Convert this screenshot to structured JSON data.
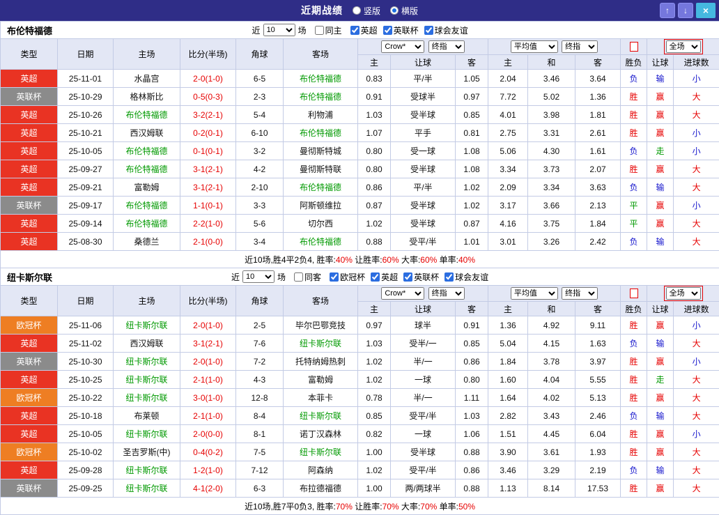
{
  "topbar": {
    "title": "近期战绩",
    "radios": [
      {
        "label": "竖版",
        "selected": false
      },
      {
        "label": "横版",
        "selected": true
      }
    ],
    "buttons": {
      "up": "↑",
      "down": "↓",
      "close": "×"
    }
  },
  "colors": {
    "topbar_bg": "#2f2d87",
    "header_bg": "#e3e7f5",
    "team_highlight": "#009900",
    "score": "#e60000",
    "badge": {
      "英超": "#e93323",
      "英联杯": "#8b8b8b",
      "欧冠杯": "#ee7e23"
    },
    "result": {
      "win": "#e60000",
      "loss": "#1414cc",
      "draw": "#009900"
    }
  },
  "table_header": {
    "left_cols": [
      "类型",
      "日期",
      "主场",
      "比分(半场)",
      "角球",
      "客场"
    ],
    "odds_selects_1": [
      "Crow*",
      "终指"
    ],
    "odds_selects_2": [
      "平均值",
      "终指"
    ],
    "scope_select": "全场",
    "sub_cols": [
      "主",
      "让球",
      "客",
      "主",
      "和",
      "客",
      "胜负",
      "让球",
      "进球数"
    ]
  },
  "sections": [
    {
      "team": "布伦特福德",
      "filter": {
        "near": "近",
        "count": "10",
        "games": "场",
        "same": {
          "label": "同主",
          "checked": false
        },
        "leagues": [
          {
            "label": "英超",
            "checked": true
          },
          {
            "label": "英联杯",
            "checked": true
          },
          {
            "label": "球会友谊",
            "checked": true
          }
        ]
      },
      "rows": [
        {
          "type": "英超",
          "date": "25-11-01",
          "home": "水晶宫",
          "home_team": false,
          "score": "2-0(1-0)",
          "corner": "6-5",
          "away": "布伦特福德",
          "away_team": true,
          "ah": [
            "0.83",
            "平/半",
            "1.05"
          ],
          "eu": [
            "2.04",
            "3.46",
            "3.64"
          ],
          "res": [
            [
              "负",
              "loss"
            ],
            [
              "输",
              "loss"
            ],
            [
              "小",
              "loss"
            ]
          ]
        },
        {
          "type": "英联杯",
          "date": "25-10-29",
          "home": "格林斯比",
          "home_team": false,
          "score": "0-5(0-3)",
          "corner": "2-3",
          "away": "布伦特福德",
          "away_team": true,
          "ah": [
            "0.91",
            "受球半",
            "0.97"
          ],
          "eu": [
            "7.72",
            "5.02",
            "1.36"
          ],
          "res": [
            [
              "胜",
              "win"
            ],
            [
              "赢",
              "win"
            ],
            [
              "大",
              "win"
            ]
          ]
        },
        {
          "type": "英超",
          "date": "25-10-26",
          "home": "布伦特福德",
          "home_team": true,
          "score": "3-2(2-1)",
          "corner": "5-4",
          "away": "利物浦",
          "away_team": false,
          "ah": [
            "1.03",
            "受半球",
            "0.85"
          ],
          "eu": [
            "4.01",
            "3.98",
            "1.81"
          ],
          "res": [
            [
              "胜",
              "win"
            ],
            [
              "赢",
              "win"
            ],
            [
              "大",
              "win"
            ]
          ]
        },
        {
          "type": "英超",
          "date": "25-10-21",
          "home": "西汉姆联",
          "home_team": false,
          "score": "0-2(0-1)",
          "corner": "6-10",
          "away": "布伦特福德",
          "away_team": true,
          "ah": [
            "1.07",
            "平手",
            "0.81"
          ],
          "eu": [
            "2.75",
            "3.31",
            "2.61"
          ],
          "res": [
            [
              "胜",
              "win"
            ],
            [
              "赢",
              "win"
            ],
            [
              "小",
              "loss"
            ]
          ]
        },
        {
          "type": "英超",
          "date": "25-10-05",
          "home": "布伦特福德",
          "home_team": true,
          "score": "0-1(0-1)",
          "corner": "3-2",
          "away": "曼彻斯特城",
          "away_team": false,
          "ah": [
            "0.80",
            "受一球",
            "1.08"
          ],
          "eu": [
            "5.06",
            "4.30",
            "1.61"
          ],
          "res": [
            [
              "负",
              "loss"
            ],
            [
              "走",
              "draw"
            ],
            [
              "小",
              "loss"
            ]
          ]
        },
        {
          "type": "英超",
          "date": "25-09-27",
          "home": "布伦特福德",
          "home_team": true,
          "score": "3-1(2-1)",
          "corner": "4-2",
          "away": "曼彻斯特联",
          "away_team": false,
          "ah": [
            "0.80",
            "受半球",
            "1.08"
          ],
          "eu": [
            "3.34",
            "3.73",
            "2.07"
          ],
          "res": [
            [
              "胜",
              "win"
            ],
            [
              "赢",
              "win"
            ],
            [
              "大",
              "win"
            ]
          ]
        },
        {
          "type": "英超",
          "date": "25-09-21",
          "home": "富勒姆",
          "home_team": false,
          "score": "3-1(2-1)",
          "corner": "2-10",
          "away": "布伦特福德",
          "away_team": true,
          "ah": [
            "0.86",
            "平/半",
            "1.02"
          ],
          "eu": [
            "2.09",
            "3.34",
            "3.63"
          ],
          "res": [
            [
              "负",
              "loss"
            ],
            [
              "输",
              "loss"
            ],
            [
              "大",
              "win"
            ]
          ]
        },
        {
          "type": "英联杯",
          "date": "25-09-17",
          "home": "布伦特福德",
          "home_team": true,
          "score": "1-1(0-1)",
          "corner": "3-3",
          "away": "阿斯顿维拉",
          "away_team": false,
          "ah": [
            "0.87",
            "受半球",
            "1.02"
          ],
          "eu": [
            "3.17",
            "3.66",
            "2.13"
          ],
          "res": [
            [
              "平",
              "draw"
            ],
            [
              "赢",
              "win"
            ],
            [
              "小",
              "loss"
            ]
          ]
        },
        {
          "type": "英超",
          "date": "25-09-14",
          "home": "布伦特福德",
          "home_team": true,
          "score": "2-2(1-0)",
          "corner": "5-6",
          "away": "切尔西",
          "away_team": false,
          "ah": [
            "1.02",
            "受半球",
            "0.87"
          ],
          "eu": [
            "4.16",
            "3.75",
            "1.84"
          ],
          "res": [
            [
              "平",
              "draw"
            ],
            [
              "赢",
              "win"
            ],
            [
              "大",
              "win"
            ]
          ]
        },
        {
          "type": "英超",
          "date": "25-08-30",
          "home": "桑德兰",
          "home_team": false,
          "score": "2-1(0-0)",
          "corner": "3-4",
          "away": "布伦特福德",
          "away_team": true,
          "ah": [
            "0.88",
            "受平/半",
            "1.01"
          ],
          "eu": [
            "3.01",
            "3.26",
            "2.42"
          ],
          "res": [
            [
              "负",
              "loss"
            ],
            [
              "输",
              "loss"
            ],
            [
              "大",
              "win"
            ]
          ]
        }
      ],
      "summary": {
        "prefix": "近10场,胜4平2负4, ",
        "stats": [
          {
            "label": "胜率:",
            "value": "40%"
          },
          {
            "label": " 让胜率:",
            "value": "60%"
          },
          {
            "label": " 大率:",
            "value": "60%"
          },
          {
            "label": " 单率:",
            "value": "40%"
          }
        ]
      }
    },
    {
      "team": "纽卡斯尔联",
      "filter": {
        "near": "近",
        "count": "10",
        "games": "场",
        "same": {
          "label": "同客",
          "checked": false
        },
        "leagues": [
          {
            "label": "欧冠杯",
            "checked": true
          },
          {
            "label": "英超",
            "checked": true
          },
          {
            "label": "英联杯",
            "checked": true
          },
          {
            "label": "球会友谊",
            "checked": true
          }
        ]
      },
      "rows": [
        {
          "type": "欧冠杯",
          "date": "25-11-06",
          "home": "纽卡斯尔联",
          "home_team": true,
          "score": "2-0(1-0)",
          "corner": "2-5",
          "away": "毕尔巴鄂竞技",
          "away_team": false,
          "ah": [
            "0.97",
            "球半",
            "0.91"
          ],
          "eu": [
            "1.36",
            "4.92",
            "9.11"
          ],
          "res": [
            [
              "胜",
              "win"
            ],
            [
              "赢",
              "win"
            ],
            [
              "小",
              "loss"
            ]
          ]
        },
        {
          "type": "英超",
          "date": "25-11-02",
          "home": "西汉姆联",
          "home_team": false,
          "score": "3-1(2-1)",
          "corner": "7-6",
          "away": "纽卡斯尔联",
          "away_team": true,
          "ah": [
            "1.03",
            "受半/一",
            "0.85"
          ],
          "eu": [
            "5.04",
            "4.15",
            "1.63"
          ],
          "res": [
            [
              "负",
              "loss"
            ],
            [
              "输",
              "loss"
            ],
            [
              "大",
              "win"
            ]
          ]
        },
        {
          "type": "英联杯",
          "date": "25-10-30",
          "home": "纽卡斯尔联",
          "home_team": true,
          "score": "2-0(1-0)",
          "corner": "7-2",
          "away": "托特纳姆热刺",
          "away_team": false,
          "ah": [
            "1.02",
            "半/一",
            "0.86"
          ],
          "eu": [
            "1.84",
            "3.78",
            "3.97"
          ],
          "res": [
            [
              "胜",
              "win"
            ],
            [
              "赢",
              "win"
            ],
            [
              "小",
              "loss"
            ]
          ]
        },
        {
          "type": "英超",
          "date": "25-10-25",
          "home": "纽卡斯尔联",
          "home_team": true,
          "score": "2-1(1-0)",
          "corner": "4-3",
          "away": "富勒姆",
          "away_team": false,
          "ah": [
            "1.02",
            "一球",
            "0.80"
          ],
          "eu": [
            "1.60",
            "4.04",
            "5.55"
          ],
          "res": [
            [
              "胜",
              "win"
            ],
            [
              "走",
              "draw"
            ],
            [
              "大",
              "win"
            ]
          ]
        },
        {
          "type": "欧冠杯",
          "date": "25-10-22",
          "home": "纽卡斯尔联",
          "home_team": true,
          "score": "3-0(1-0)",
          "corner": "12-8",
          "away": "本菲卡",
          "away_team": false,
          "ah": [
            "0.78",
            "半/一",
            "1.11"
          ],
          "eu": [
            "1.64",
            "4.02",
            "5.13"
          ],
          "res": [
            [
              "胜",
              "win"
            ],
            [
              "赢",
              "win"
            ],
            [
              "大",
              "win"
            ]
          ]
        },
        {
          "type": "英超",
          "date": "25-10-18",
          "home": "布莱顿",
          "home_team": false,
          "score": "2-1(1-0)",
          "corner": "8-4",
          "away": "纽卡斯尔联",
          "away_team": true,
          "ah": [
            "0.85",
            "受平/半",
            "1.03"
          ],
          "eu": [
            "2.82",
            "3.43",
            "2.46"
          ],
          "res": [
            [
              "负",
              "loss"
            ],
            [
              "输",
              "loss"
            ],
            [
              "大",
              "win"
            ]
          ]
        },
        {
          "type": "英超",
          "date": "25-10-05",
          "home": "纽卡斯尔联",
          "home_team": true,
          "score": "2-0(0-0)",
          "corner": "8-1",
          "away": "诺丁汉森林",
          "away_team": false,
          "ah": [
            "0.82",
            "一球",
            "1.06"
          ],
          "eu": [
            "1.51",
            "4.45",
            "6.04"
          ],
          "res": [
            [
              "胜",
              "win"
            ],
            [
              "赢",
              "win"
            ],
            [
              "小",
              "loss"
            ]
          ]
        },
        {
          "type": "欧冠杯",
          "date": "25-10-02",
          "home": "圣吉罗斯(中)",
          "home_team": false,
          "score": "0-4(0-2)",
          "corner": "7-5",
          "away": "纽卡斯尔联",
          "away_team": true,
          "ah": [
            "1.00",
            "受半球",
            "0.88"
          ],
          "eu": [
            "3.90",
            "3.61",
            "1.93"
          ],
          "res": [
            [
              "胜",
              "win"
            ],
            [
              "赢",
              "win"
            ],
            [
              "大",
              "win"
            ]
          ]
        },
        {
          "type": "英超",
          "date": "25-09-28",
          "home": "纽卡斯尔联",
          "home_team": true,
          "score": "1-2(1-0)",
          "corner": "7-12",
          "away": "阿森纳",
          "away_team": false,
          "ah": [
            "1.02",
            "受平/半",
            "0.86"
          ],
          "eu": [
            "3.46",
            "3.29",
            "2.19"
          ],
          "res": [
            [
              "负",
              "loss"
            ],
            [
              "输",
              "loss"
            ],
            [
              "大",
              "win"
            ]
          ]
        },
        {
          "type": "英联杯",
          "date": "25-09-25",
          "home": "纽卡斯尔联",
          "home_team": true,
          "score": "4-1(2-0)",
          "corner": "6-3",
          "away": "布拉德福德",
          "away_team": false,
          "ah": [
            "1.00",
            "两/两球半",
            "0.88"
          ],
          "eu": [
            "1.13",
            "8.14",
            "17.53"
          ],
          "res": [
            [
              "胜",
              "win"
            ],
            [
              "赢",
              "win"
            ],
            [
              "大",
              "win"
            ]
          ]
        }
      ],
      "summary": {
        "prefix": "近10场,胜7平0负3, ",
        "stats": [
          {
            "label": "胜率:",
            "value": "70%"
          },
          {
            "label": " 让胜率:",
            "value": "70%"
          },
          {
            "label": " 大率:",
            "value": "70%"
          },
          {
            "label": " 单率:",
            "value": "50%"
          }
        ]
      }
    }
  ]
}
